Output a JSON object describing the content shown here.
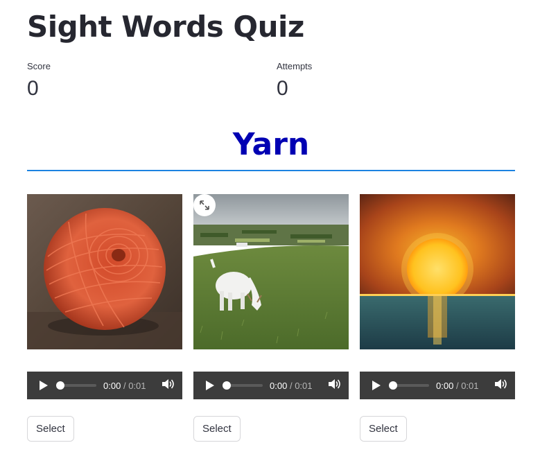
{
  "page": {
    "title": "Sight Words Quiz"
  },
  "metrics": [
    {
      "label": "Score",
      "value": "0"
    },
    {
      "label": "Attempts",
      "value": "0"
    }
  ],
  "quiz": {
    "target_word": "Yarn"
  },
  "options": [
    {
      "image": "ball-of-yarn-photo",
      "audio": {
        "current": "0:00",
        "separator": "/",
        "duration": "0:01",
        "progress": 0
      },
      "button_label": "Select"
    },
    {
      "image": "goat-grazing-photo",
      "audio": {
        "current": "0:00",
        "separator": "/",
        "duration": "0:01",
        "progress": 0
      },
      "button_label": "Select"
    },
    {
      "image": "sunset-over-sea-photo",
      "audio": {
        "current": "0:00",
        "separator": "/",
        "duration": "0:01",
        "progress": 0
      },
      "button_label": "Select"
    }
  ],
  "icons": {
    "play": "play-icon",
    "volume": "volume-icon",
    "expand": "fullscreen-expand-icon"
  },
  "colors": {
    "target_word": "#0000b3",
    "rule": "#1c83e1",
    "player_bg": "#3c3c3c"
  }
}
